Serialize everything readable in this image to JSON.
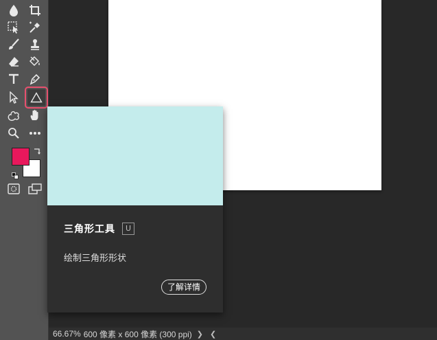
{
  "colors": {
    "foreground": "#e8185c",
    "background": "#ffffff",
    "selected_outline": "#e8506e",
    "preview": "#c4ecec"
  },
  "tools": [
    {
      "name": "blur-tool-icon"
    },
    {
      "name": "crop-tool-icon"
    },
    {
      "name": "object-selection-tool-icon"
    },
    {
      "name": "eyedropper-tool-icon"
    },
    {
      "name": "brush-tool-icon"
    },
    {
      "name": "clone-stamp-tool-icon"
    },
    {
      "name": "eraser-tool-icon"
    },
    {
      "name": "paint-bucket-tool-icon"
    },
    {
      "name": "type-tool-icon"
    },
    {
      "name": "pen-tool-icon"
    },
    {
      "name": "move-tool-icon"
    },
    {
      "name": "triangle-tool-icon",
      "selected": true
    },
    {
      "name": "custom-shape-tool-icon"
    },
    {
      "name": "hand-tool-icon"
    },
    {
      "name": "zoom-tool-icon"
    },
    {
      "name": "more-tools-icon"
    }
  ],
  "tooltip": {
    "title": "三角形工具",
    "shortcut": "U",
    "description": "绘制三角形形状",
    "learn_more": "了解详情"
  },
  "status": {
    "zoom": "66.67%",
    "doc_info": "600 像素 x 600 像素 (300 ppi)",
    "next_arrow": "❯",
    "prev_arrow": "❮"
  }
}
